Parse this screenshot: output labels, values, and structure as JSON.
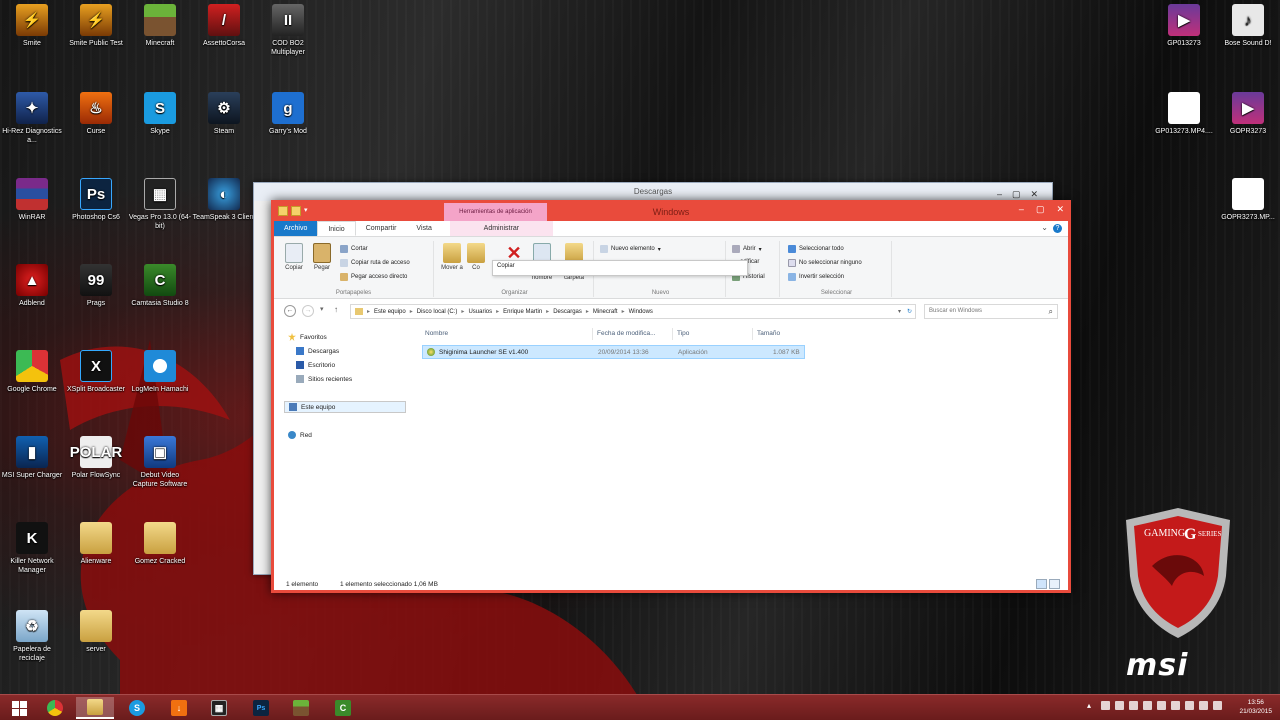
{
  "desktop": {
    "icons": [
      {
        "label": "Smite",
        "icon": "smite-icon"
      },
      {
        "label": "Smite Public Test",
        "icon": "smite-test-icon"
      },
      {
        "label": "Minecraft",
        "icon": "minecraft-icon"
      },
      {
        "label": "AssettoCorsa",
        "icon": "assetto-corsa-icon"
      },
      {
        "label": "COD BO2 Multiplayer",
        "icon": "cod-icon"
      },
      {
        "label": "Hi-Rez Diagnostics a...",
        "icon": "hirez-icon"
      },
      {
        "label": "Curse",
        "icon": "curse-icon"
      },
      {
        "label": "Skype",
        "icon": "skype-icon"
      },
      {
        "label": "Steam",
        "icon": "steam-icon"
      },
      {
        "label": "Garry's Mod",
        "icon": "gmod-icon"
      },
      {
        "label": "WinRAR",
        "icon": "winrar-icon"
      },
      {
        "label": "Photoshop Cs6",
        "icon": "photoshop-icon"
      },
      {
        "label": "Vegas Pro 13.0 (64-bit)",
        "icon": "vegas-icon"
      },
      {
        "label": "TeamSpeak 3 Client",
        "icon": "teamspeak-icon"
      },
      {
        "label": "Adblend",
        "icon": "adblend-icon"
      },
      {
        "label": "Prags",
        "icon": "prags-icon"
      },
      {
        "label": "Camtasia Studio 8",
        "icon": "camtasia-icon"
      },
      {
        "label": "Google Chrome",
        "icon": "chrome-icon"
      },
      {
        "label": "XSplit Broadcaster",
        "icon": "xsplit-icon"
      },
      {
        "label": "LogMeIn Hamachi",
        "icon": "hamachi-icon"
      },
      {
        "label": "MSI Super Charger",
        "icon": "msi-charger-icon"
      },
      {
        "label": "Polar FlowSync",
        "icon": "polar-icon"
      },
      {
        "label": "Debut Video Capture Software",
        "icon": "debut-icon"
      },
      {
        "label": "Killer Network Manager",
        "icon": "killer-icon"
      },
      {
        "label": "Alienware",
        "icon": "folder-icon"
      },
      {
        "label": "Gomez Cracked",
        "icon": "folder-icon"
      },
      {
        "label": "Papelera de reciclaje",
        "icon": "recycle-bin-icon"
      },
      {
        "label": "server",
        "icon": "folder-icon"
      },
      {
        "label": "GP013273",
        "icon": "video-file-icon"
      },
      {
        "label": "Bose Sound D!",
        "icon": "sound-file-icon"
      },
      {
        "label": "GP013273.MP4....",
        "icon": "file-icon"
      },
      {
        "label": "GOPR3273",
        "icon": "mp4-file-icon"
      },
      {
        "label": "GOPR3273.MP...",
        "icon": "file-icon"
      }
    ]
  },
  "back_window": {
    "title": "Descargas"
  },
  "window": {
    "title": "Windows",
    "context_header": "Herramientas de aplicación",
    "tabs": [
      "Archivo",
      "Inicio",
      "Compartir",
      "Vista",
      "Administrar"
    ],
    "ribbon": {
      "clipboard": {
        "copy": "Copiar",
        "paste": "Pegar",
        "cut": "Cortar",
        "copy_path": "Copiar ruta de acceso",
        "paste_shortcut": "Pegar acceso directo",
        "group": "Portapapeles"
      },
      "organize": {
        "move": "Mover a",
        "copy_to": "Co",
        "rename": "nombre",
        "new_folder": "carpeta",
        "group": "Organizar"
      },
      "new": {
        "new_item": "Nuevo elemento",
        "group": "Nuevo"
      },
      "open": {
        "open": "Abrir",
        "modify": "odificar",
        "history": "Historial"
      },
      "select": {
        "select_all": "Seleccionar todo",
        "select_none": "No seleccionar ninguno",
        "invert": "Invertir selección",
        "group": "Seleccionar"
      },
      "tooltip": "Copiar"
    },
    "address": {
      "crumbs": [
        "Este equipo",
        "Disco local (C:)",
        "Usuarios",
        "Enrique Martin",
        "Descargas",
        "Minecraft",
        "Windows"
      ],
      "search_placeholder": "Buscar en Windows"
    },
    "nav": {
      "favorites": "Favoritos",
      "downloads": "Descargas",
      "desktop": "Escritorio",
      "recent": "Sitios recientes",
      "this_pc": "Este equipo",
      "network": "Red"
    },
    "columns": {
      "name": "Nombre",
      "date": "Fecha de modifica...",
      "type": "Tipo",
      "size": "Tamaño"
    },
    "files": [
      {
        "name": "Shiginima Launcher SE v1.400",
        "date": "20/09/2014 13:36",
        "type": "Aplicación",
        "size": "1.087 KB"
      }
    ],
    "status": {
      "count": "1 elemento",
      "selected": "1 elemento seleccionado  1,06 MB"
    }
  },
  "badge": {
    "text": "GAMING",
    "series": "SERIES",
    "letter": "G",
    "brand": "msi"
  },
  "taskbar": {
    "apps": [
      "start",
      "chrome",
      "explorer",
      "skype",
      "curse",
      "vegas",
      "photoshop",
      "minecraft",
      "camtasia"
    ],
    "clock": {
      "time": "13:56",
      "date": "21/03/2015"
    }
  },
  "colors": {
    "accent": "#e94b3c",
    "ribbon_file_tab": "#1979ca",
    "selection": "#cce8ff",
    "taskbar": "#7a2424"
  }
}
